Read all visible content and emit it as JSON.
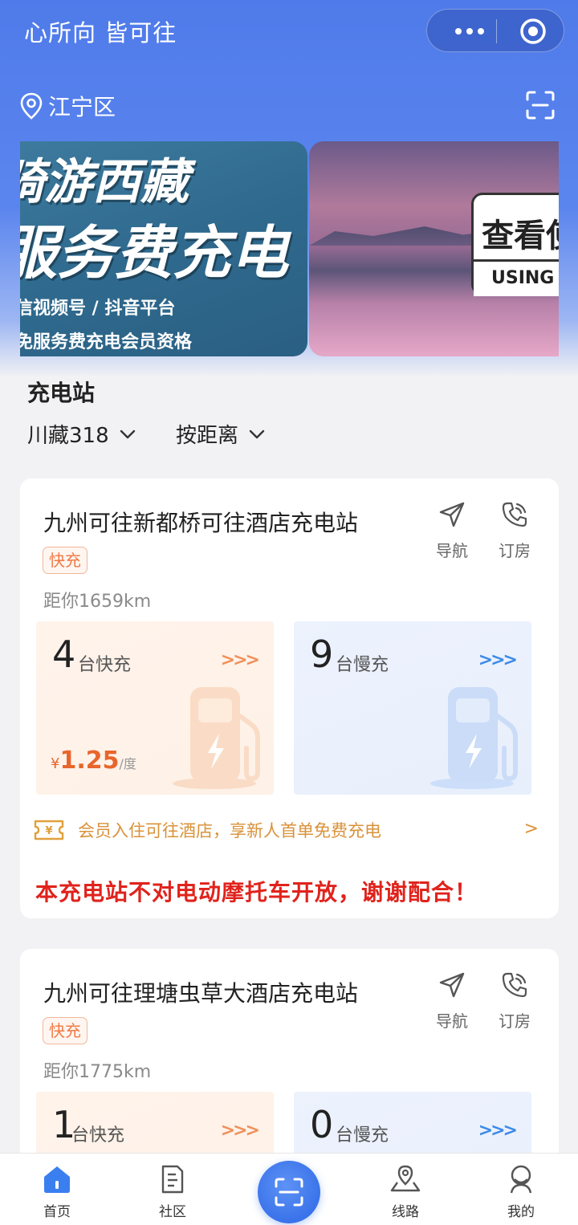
{
  "header": {
    "app_title": "心所向 皆可往",
    "location": "江宁区"
  },
  "banner": {
    "slide1_line1": "骑游西藏",
    "slide1_line2": "服务费充电",
    "slide1_line3": "信视频号 / 抖音平台",
    "slide1_line4": "免服务费充电会员资格",
    "slide2_title": "查看使",
    "slide2_sub": "USING T"
  },
  "section": {
    "title": "充电站",
    "filter_route": "川藏318",
    "filter_sort": "按距离"
  },
  "stations": [
    {
      "name": "九州可往新都桥可往酒店充电站",
      "tag": "快充",
      "distance": "距你1659km",
      "nav_label": "导航",
      "book_label": "订房",
      "fast_count": "4",
      "fast_unit": "台快充",
      "slow_count": "9",
      "slow_unit": "台慢充",
      "price_symbol": "¥",
      "price_value": "1.25",
      "price_unit": "/度",
      "promo": "会员入住可往酒店，享新人首单免费充电",
      "notice": "本充电站不对电动摩托车开放，谢谢配合！"
    },
    {
      "name": "九州可往理塘虫草大酒店充电站",
      "tag": "快充",
      "distance": "距你1775km",
      "nav_label": "导航",
      "book_label": "订房",
      "fast_count": "1",
      "fast_unit": "台快充",
      "slow_count": "0",
      "slow_unit": "台慢充"
    }
  ],
  "tabbar": {
    "home": "首页",
    "community": "社区",
    "route": "线路",
    "mine": "我的"
  },
  "colors": {
    "brand_blue": "#4f7bea",
    "fast_orange": "#f07a44",
    "notice_red": "#e0231c",
    "promo_gold": "#d9923a"
  },
  "icons": [
    "more-dots-icon",
    "target-icon",
    "location-pin-icon",
    "scan-icon",
    "navigate-icon",
    "phone-icon",
    "chevron-down-icon",
    "coupon-icon",
    "home-icon",
    "community-icon",
    "route-icon",
    "profile-icon"
  ]
}
